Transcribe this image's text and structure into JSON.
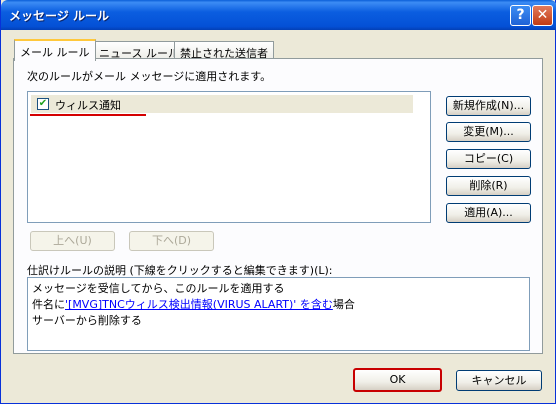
{
  "window": {
    "title": "メッセージ ルール",
    "help_glyph": "?",
    "close_glyph": "✕"
  },
  "tabs": [
    {
      "label": "メール ルール",
      "active": true
    },
    {
      "label": "ニュース ルール",
      "active": false
    },
    {
      "label": "禁止された送信者",
      "active": false
    }
  ],
  "panel": {
    "header": "次のルールがメール メッセージに適用されます。",
    "rules": [
      {
        "label": "ウィルス通知",
        "checked": true,
        "check_glyph": "✔"
      }
    ],
    "side_buttons": {
      "new": "新規作成(N)...",
      "modify": "変更(M)...",
      "copy": "コピー(C)",
      "delete": "削除(R)",
      "apply": "適用(A)..."
    },
    "move_up": "上へ(U)",
    "move_down": "下へ(D)",
    "desc_label": "仕訳けルールの説明 (下線をクリックすると編集できます)(L):",
    "desc": {
      "line1": "メッセージを受信してから、このルールを適用する",
      "line2_prefix": "件名に",
      "line2_link": "'[MVG]TNCウィルス検出情報(VIRUS ALART)' を含む",
      "line2_suffix": "場合",
      "line3": "サーバーから削除する"
    }
  },
  "footer": {
    "ok": "OK",
    "cancel": "キャンセル"
  },
  "colors": {
    "titlebar": "#0450d6",
    "highlight_border": "#c80000",
    "link": "#0000ff"
  }
}
